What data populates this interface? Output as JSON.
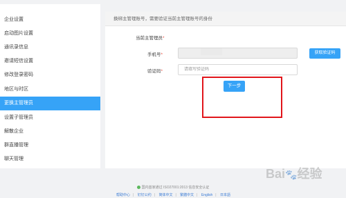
{
  "sidebar": {
    "items": [
      {
        "label": "企业设置"
      },
      {
        "label": "启动图片设置"
      },
      {
        "label": "通讯录信息"
      },
      {
        "label": "邀请短信设置"
      },
      {
        "label": "修改登录密码"
      },
      {
        "label": "地区与时区"
      },
      {
        "label": "更换主管理员",
        "active": true
      },
      {
        "label": "设置子管理员"
      },
      {
        "label": "解散企业"
      },
      {
        "label": "群直播管理"
      },
      {
        "label": "聊天管理"
      }
    ]
  },
  "main": {
    "header": "换绑主管理账号，需要验证当前主管理账号的身份",
    "current_admin_label": "当前主管理员",
    "phone_label": "手机号",
    "phone_value": "",
    "code_label": "验证码",
    "code_placeholder": "请填写验证码",
    "get_code_button": "获取验证码",
    "next_button": "下一步",
    "required_mark": "*"
  },
  "footer": {
    "note": "国内首家通过 ISO27001:2013 信息安全认证",
    "links": [
      "帮助中心",
      "钉钉公约",
      "简体中文",
      "繁體中文",
      "English",
      "日本語"
    ]
  },
  "watermark": {
    "text": "Bai",
    "suffix": "经验"
  },
  "colors": {
    "accent": "#36a3f7",
    "highlight_box": "#e1141a",
    "required": "#e84c3d"
  }
}
